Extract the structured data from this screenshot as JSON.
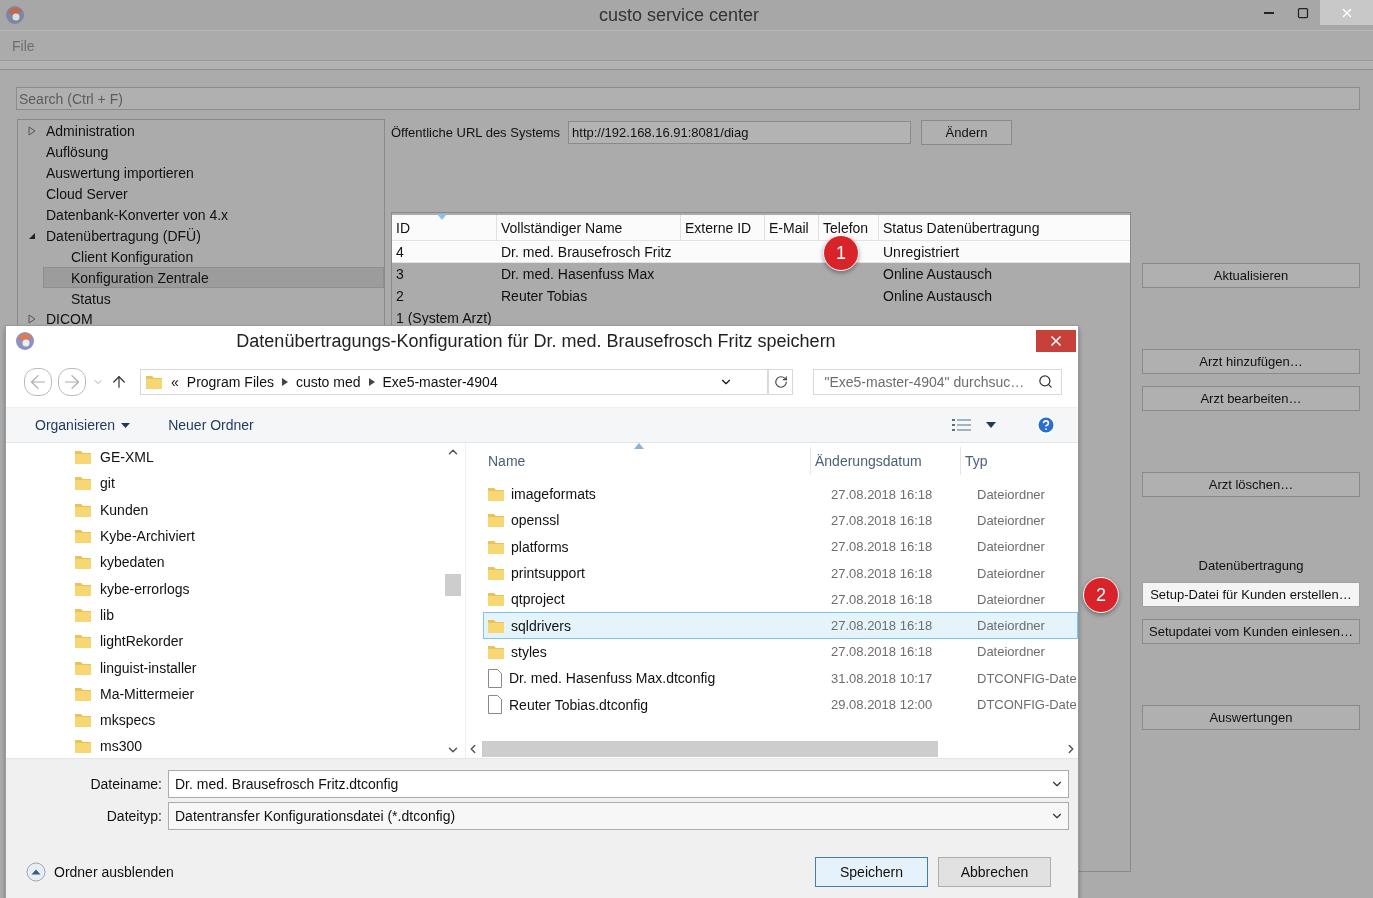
{
  "main_window": {
    "title": "custo service center",
    "menu": [
      {
        "label": "File"
      }
    ],
    "search": {
      "placeholder": "Search (Ctrl + F)"
    },
    "tree": [
      {
        "label": "Administration",
        "expanded": false,
        "selected": false
      },
      {
        "label": "Auflösung",
        "selected": false
      },
      {
        "label": "Auswertung importieren",
        "selected": false
      },
      {
        "label": "Cloud Server",
        "selected": false
      },
      {
        "label": "Datenbank-Konverter von 4.x",
        "selected": false
      },
      {
        "label": "Datenübertragung (DFÜ)",
        "expanded": true,
        "selected": false,
        "children": [
          {
            "label": "Client Konfiguration",
            "selected": false
          },
          {
            "label": "Konfiguration Zentrale",
            "selected": true
          },
          {
            "label": "Status",
            "selected": false
          }
        ]
      },
      {
        "label": "DICOM",
        "expanded": false,
        "selected": false
      }
    ],
    "url": {
      "label": "Öffentliche URL des Systems",
      "value": "http://192.168.16.91:8081/diag",
      "button": "Ändern"
    },
    "table": {
      "header_highlighted": true,
      "columns": [
        "ID",
        "Vollständiger Name",
        "Externe ID",
        "E-Mail",
        "Telefon",
        "Status Datenübertragung"
      ],
      "rows": [
        {
          "id": "4",
          "full_name": "Dr. med. Brausefrosch Fritz",
          "status": "Unregistriert",
          "highlighted": true,
          "callout": "1"
        },
        {
          "id": "3",
          "full_name": "Dr. med. Hasenfuss Max",
          "status": "Online Austausch",
          "highlighted": false
        },
        {
          "id": "2",
          "full_name": "Reuter Tobias",
          "status": "Online Austausch",
          "highlighted": false
        },
        {
          "id": "1 (System Arzt)",
          "highlighted": false
        }
      ]
    },
    "actions": [
      {
        "buttons": [
          {
            "label": "Aktualisieren",
            "highlighted": false
          }
        ]
      },
      {
        "buttons": [
          {
            "label": "Arzt hinzufügen…",
            "highlighted": false
          },
          {
            "label": "Arzt bearbeiten…",
            "highlighted": false
          }
        ]
      },
      {
        "buttons": [
          {
            "label": "Arzt löschen…",
            "highlighted": false
          }
        ]
      },
      {
        "label": "Datenübertragung",
        "buttons": [
          {
            "label": "Setup-Datei für Kunden erstellen…",
            "highlighted": true,
            "callout": "2"
          },
          {
            "label": "Setupdatei vom Kunden einlesen…",
            "highlighted": false
          }
        ]
      },
      {
        "buttons": [
          {
            "label": "Auswertungen",
            "highlighted": false
          }
        ]
      }
    ]
  },
  "dialog": {
    "title": "Datenübertragungs-Konfiguration für Dr. med. Brausefrosch Fritz speichern",
    "breadcrumb": {
      "overflow": "«",
      "parts": [
        "Program Files",
        "custo med",
        "Exe5-master-4904"
      ]
    },
    "search": {
      "placeholder": "\"Exe5-master-4904\" durchsuc…"
    },
    "toolbar": {
      "organize": "Organisieren",
      "new_folder": "Neuer Ordner"
    },
    "folders": [
      "GE-XML",
      "git",
      "Kunden",
      "Kybe-Archiviert",
      "kybedaten",
      "kybe-errorlogs",
      "lib",
      "lightRekorder",
      "linguist-installer",
      "Ma-Mittermeier",
      "mkspecs",
      "ms300"
    ],
    "columns": [
      "Name",
      "Änderungsdatum",
      "Typ"
    ],
    "files": [
      {
        "kind": "folder",
        "name": "imageformats",
        "date": "27.08.2018 16:18",
        "type": "Dateiordner",
        "selected": false
      },
      {
        "kind": "folder",
        "name": "openssl",
        "date": "27.08.2018 16:18",
        "type": "Dateiordner",
        "selected": false
      },
      {
        "kind": "folder",
        "name": "platforms",
        "date": "27.08.2018 16:18",
        "type": "Dateiordner",
        "selected": false
      },
      {
        "kind": "folder",
        "name": "printsupport",
        "date": "27.08.2018 16:18",
        "type": "Dateiordner",
        "selected": false
      },
      {
        "kind": "folder",
        "name": "qtproject",
        "date": "27.08.2018 16:18",
        "type": "Dateiordner",
        "selected": false
      },
      {
        "kind": "folder",
        "name": "sqldrivers",
        "date": "27.08.2018 16:18",
        "type": "Dateiordner",
        "selected": true
      },
      {
        "kind": "folder",
        "name": "styles",
        "date": "27.08.2018 16:18",
        "type": "Dateiordner",
        "selected": false
      },
      {
        "kind": "file",
        "name": "Dr. med. Hasenfuss Max.dtconfig",
        "date": "31.08.2018 10:17",
        "type": "DTCONFIG-Date",
        "selected": false
      },
      {
        "kind": "file",
        "name": "Reuter Tobias.dtconfig",
        "date": "29.08.2018 12:00",
        "type": "DTCONFIG-Date",
        "selected": false
      }
    ],
    "filename": {
      "label": "Dateiname:",
      "value": "Dr. med. Brausefrosch Fritz.dtconfig"
    },
    "filetype": {
      "label": "Dateityp:",
      "value": "Datentransfer Konfigurationsdatei (*.dtconfig)"
    },
    "hide_folders": "Ordner ausblenden",
    "buttons": [
      {
        "label": "Speichern",
        "default": true
      },
      {
        "label": "Abbrechen",
        "default": false
      }
    ]
  }
}
